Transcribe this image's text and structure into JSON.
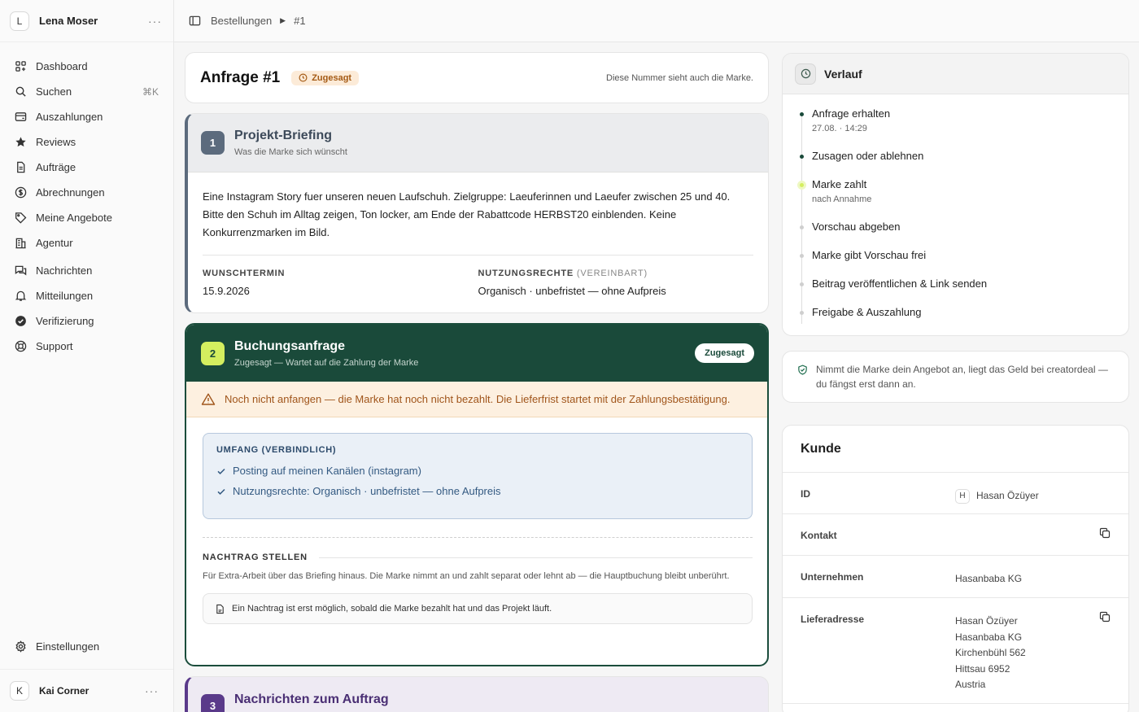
{
  "sidebar": {
    "user": {
      "initial": "L",
      "name": "Lena Moser"
    },
    "items": [
      {
        "label": "Dashboard",
        "icon": "dashboard-icon"
      },
      {
        "label": "Suchen",
        "icon": "search-icon",
        "shortcut": "⌘K"
      },
      {
        "label": "Auszahlungen",
        "icon": "wallet-icon"
      },
      {
        "label": "Reviews",
        "icon": "star-icon"
      },
      {
        "label": "Aufträge",
        "icon": "document-icon"
      },
      {
        "label": "Abrechnungen",
        "icon": "dollar-icon"
      },
      {
        "label": "Meine Angebote",
        "icon": "tag-icon"
      },
      {
        "label": "Agentur",
        "icon": "building-icon"
      },
      {
        "label": "Nachrichten",
        "icon": "chat-icon"
      },
      {
        "label": "Mitteilungen",
        "icon": "bell-icon"
      },
      {
        "label": "Verifizierung",
        "icon": "check-badge-icon"
      },
      {
        "label": "Support",
        "icon": "lifebuoy-icon"
      }
    ],
    "settings_label": "Einstellungen",
    "bottom_user": {
      "initial": "K",
      "name": "Kai Corner"
    }
  },
  "breadcrumb": {
    "root": "Bestellungen",
    "current": "#1"
  },
  "request": {
    "title": "Anfrage #1",
    "status": "Zugesagt",
    "note": "Diese Nummer sieht auch die Marke."
  },
  "briefing": {
    "step": "1",
    "title": "Projekt-Briefing",
    "subtitle": "Was die Marke sich wünscht",
    "text": "Eine Instagram Story fuer unseren neuen Laufschuh. Zielgruppe: Laeuferinnen und Laeufer zwischen 25 und 40. Bitte den Schuh im Alltag zeigen, Ton locker, am Ende der Rabattcode HERBST20 einblenden. Keine Konkurrenzmarken im Bild.",
    "date_label": "WUNSCHTERMIN",
    "date_value": "15.9.2026",
    "rights_label": "NUTZUNGSRECHTE",
    "rights_tag": "(VEREINBART)",
    "rights_value": "Organisch · unbefristet — ohne Aufpreis"
  },
  "booking": {
    "step": "2",
    "title": "Buchungsanfrage",
    "subtitle": "Zugesagt — Wartet auf die Zahlung der Marke",
    "badge": "Zugesagt",
    "warning": "Noch nicht anfangen — die Marke hat noch nicht bezahlt. Die Lieferfrist startet mit der Zahlungsbestätigung.",
    "scope_title": "UMFANG (VERBINDLICH)",
    "scope_items": [
      "Posting auf meinen Kanälen (instagram)",
      "Nutzungsrechte: Organisch · unbefristet — ohne Aufpreis"
    ],
    "addendum_title": "NACHTRAG STELLEN",
    "addendum_text": "Für Extra-Arbeit über das Briefing hinaus. Die Marke nimmt an und zahlt separat oder lehnt ab — die Hauptbuchung bleibt unberührt.",
    "addendum_note": "Ein Nachtrag ist erst möglich, sobald die Marke bezahlt hat und das Projekt läuft."
  },
  "messages": {
    "step": "3",
    "title": "Nachrichten zum Auftrag"
  },
  "history": {
    "title": "Verlauf",
    "steps": [
      {
        "label": "Anfrage erhalten",
        "sub": "27.08. · 14:29",
        "state": "done"
      },
      {
        "label": "Zusagen oder ablehnen",
        "sub": "",
        "state": "done"
      },
      {
        "label": "Marke zahlt",
        "sub": "nach Annahme",
        "state": "current"
      },
      {
        "label": "Vorschau abgeben",
        "sub": "",
        "state": "pending"
      },
      {
        "label": "Marke gibt Vorschau frei",
        "sub": "",
        "state": "pending"
      },
      {
        "label": "Beitrag veröffentlichen & Link senden",
        "sub": "",
        "state": "pending"
      },
      {
        "label": "Freigabe & Auszahlung",
        "sub": "",
        "state": "pending"
      }
    ]
  },
  "info_note": "Nimmt die Marke dein Angebot an, liegt das Geld bei creatordeal — du fängst erst dann an.",
  "customer": {
    "title": "Kunde",
    "id_label": "ID",
    "id_initial": "H",
    "id_value": "Hasan Özüyer",
    "contact_label": "Kontakt",
    "company_label": "Unternehmen",
    "company_value": "Hasanbaba KG",
    "address_label": "Lieferadresse",
    "address_lines": [
      "Hasan Özüyer",
      "Hasanbaba KG",
      "Kirchenbühl 562",
      "Hittsau 6952",
      "Austria"
    ]
  },
  "colors": {
    "accent_green": "#1a4a3a",
    "lime": "#d4ee5f",
    "warning_bg": "#fdf0e0",
    "slate": "#5c6b7d",
    "purple": "#5a3a8a"
  }
}
